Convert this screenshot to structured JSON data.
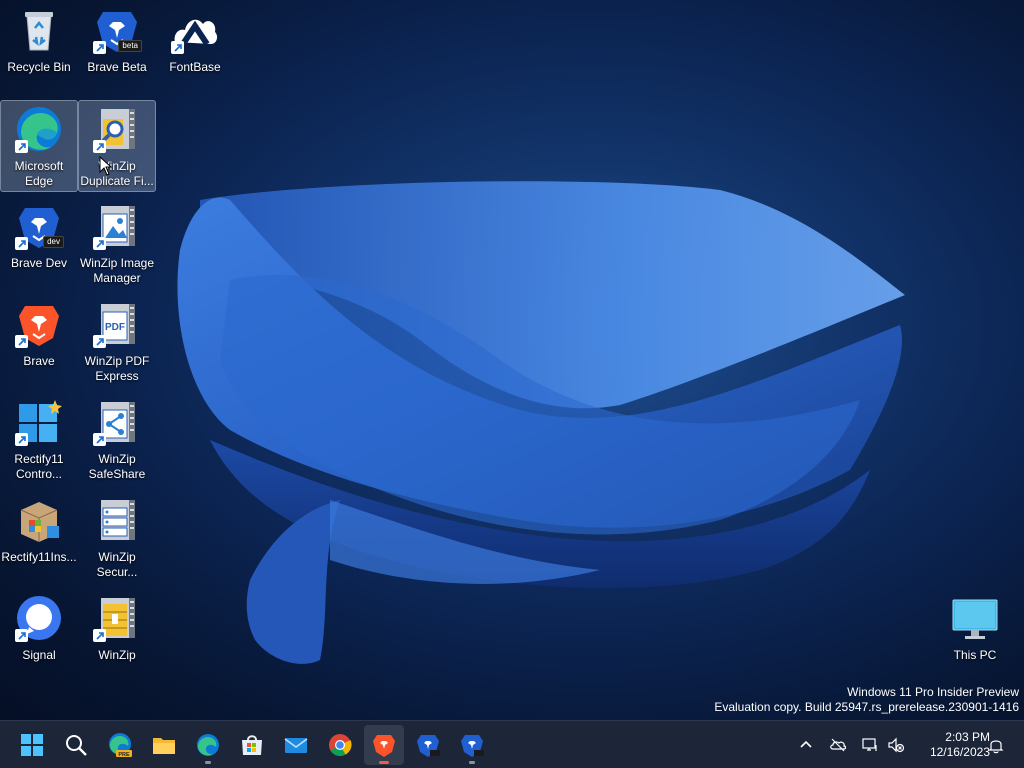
{
  "desktop": {
    "icons": [
      {
        "id": "recycle-bin",
        "label": "Recycle Bin",
        "icon": "recycle-bin-icon"
      },
      {
        "id": "brave-beta",
        "label": "Brave Beta",
        "icon": "brave-lion-icon",
        "tag": "beta"
      },
      {
        "id": "fontbase",
        "label": "FontBase",
        "icon": "fontbase-icon"
      },
      {
        "id": "microsoft-edge",
        "label": "Microsoft Edge",
        "icon": "edge-icon"
      },
      {
        "id": "winzip-duplicate-finder",
        "label": "WinZip Duplicate Fi...",
        "icon": "winzip-duplicate-icon"
      },
      {
        "id": "brave-dev",
        "label": "Brave Dev",
        "icon": "brave-lion-icon",
        "tag": "dev"
      },
      {
        "id": "winzip-image-manager",
        "label": "WinZip Image Manager",
        "icon": "winzip-image-icon"
      },
      {
        "id": "brave",
        "label": "Brave",
        "icon": "brave-lion-icon"
      },
      {
        "id": "winzip-pdf-express",
        "label": "WinZip PDF Express",
        "icon": "winzip-pdf-icon",
        "badge": "PDF"
      },
      {
        "id": "rectify11-control",
        "label": "Rectify11 Contro...",
        "icon": "rectify11-icon"
      },
      {
        "id": "winzip-safeshare",
        "label": "WinZip SafeShare",
        "icon": "winzip-safeshare-icon"
      },
      {
        "id": "rectify11-installer",
        "label": "Rectify11Ins...",
        "icon": "installer-box-icon"
      },
      {
        "id": "winzip-secure",
        "label": "WinZip Secur...",
        "icon": "winzip-secure-icon"
      },
      {
        "id": "signal",
        "label": "Signal",
        "icon": "signal-icon"
      },
      {
        "id": "winzip",
        "label": "WinZip",
        "icon": "winzip-icon"
      },
      {
        "id": "this-pc",
        "label": "This PC",
        "icon": "monitor-icon"
      }
    ],
    "selected": "winzip-duplicate-finder"
  },
  "watermark": {
    "line1": "Windows 11 Pro Insider Preview",
    "line2": "Evaluation copy. Build 25947.rs_prerelease.230901-1416"
  },
  "taskbar": {
    "apps": [
      {
        "id": "start",
        "icon": "windows-logo-icon"
      },
      {
        "id": "search",
        "icon": "search-icon"
      },
      {
        "id": "edge-preview",
        "icon": "edge-pre-icon",
        "tag": "PRE"
      },
      {
        "id": "file-explorer",
        "icon": "folder-icon"
      },
      {
        "id": "edge",
        "icon": "edge-icon",
        "running": true
      },
      {
        "id": "microsoft-store",
        "icon": "store-icon"
      },
      {
        "id": "mail",
        "icon": "mail-icon"
      },
      {
        "id": "chrome",
        "icon": "chrome-icon"
      },
      {
        "id": "brave",
        "icon": "brave-lion-icon",
        "running": true,
        "active": true
      },
      {
        "id": "brave-dev",
        "icon": "brave-dev-icon"
      },
      {
        "id": "brave-beta",
        "icon": "brave-beta-icon",
        "running": true
      }
    ],
    "tray": {
      "icons": [
        "chevron-up-icon",
        "cloud-off-icon",
        "network-icon",
        "volume-muted-icon",
        "notification-bell-icon"
      ],
      "time": "2:03 PM",
      "date": "12/16/2023"
    }
  },
  "colors": {
    "taskbar_bg": "#1c2638",
    "brave_orange": "#fb542b",
    "brave_blue": "#1f5fd1",
    "edge_teal": "#0aa5a5",
    "winzip_yellow": "#f2c233"
  }
}
